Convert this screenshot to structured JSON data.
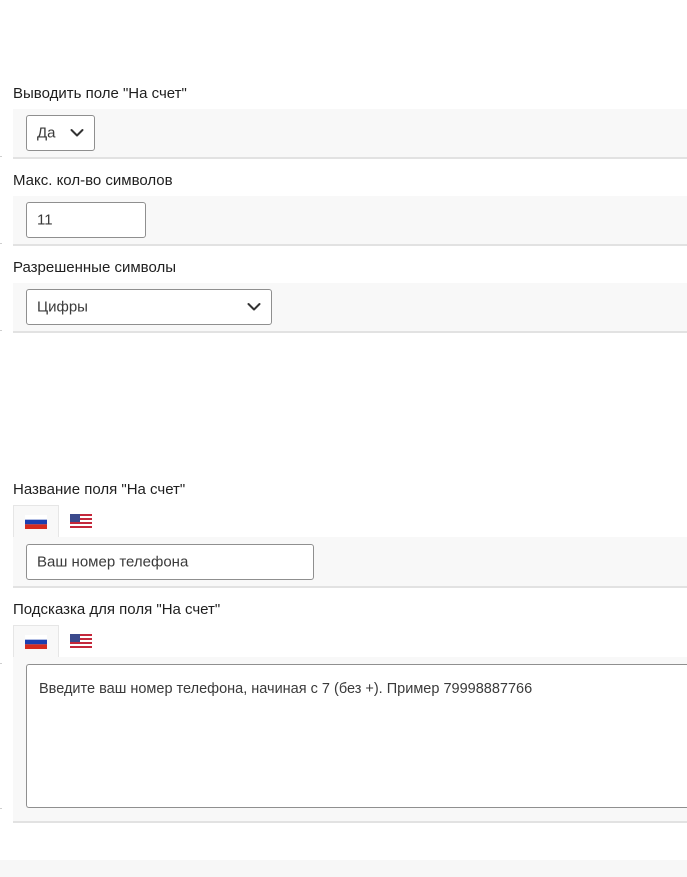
{
  "fields": {
    "show_account_field": {
      "label": "Выводить поле \"На счет\"",
      "value": "Да",
      "icon": "chevron-down-icon"
    },
    "max_chars": {
      "label": "Макс. кол-во символов",
      "value": "11"
    },
    "allowed_chars": {
      "label": "Разрешенные символы",
      "value": "Цифры",
      "icon": "chevron-down-icon"
    },
    "account_field_name": {
      "label": "Название поля \"На счет\"",
      "languages": [
        "ru-flag-icon",
        "us-flag-icon"
      ],
      "active_language": "ru-flag-icon",
      "value": "Ваш номер телефона"
    },
    "account_field_hint": {
      "label": "Подсказка для поля \"На счет\"",
      "languages": [
        "ru-flag-icon",
        "us-flag-icon"
      ],
      "active_language": "ru-flag-icon",
      "value": "Введите ваш номер телефона, начиная с 7 (без +). Пример 79998887766"
    }
  },
  "colors": {
    "band": "#f8f8f8",
    "rule": "#e2e2e2",
    "control_border": "#8f8f8f",
    "label_text": "#1f1f1f"
  }
}
